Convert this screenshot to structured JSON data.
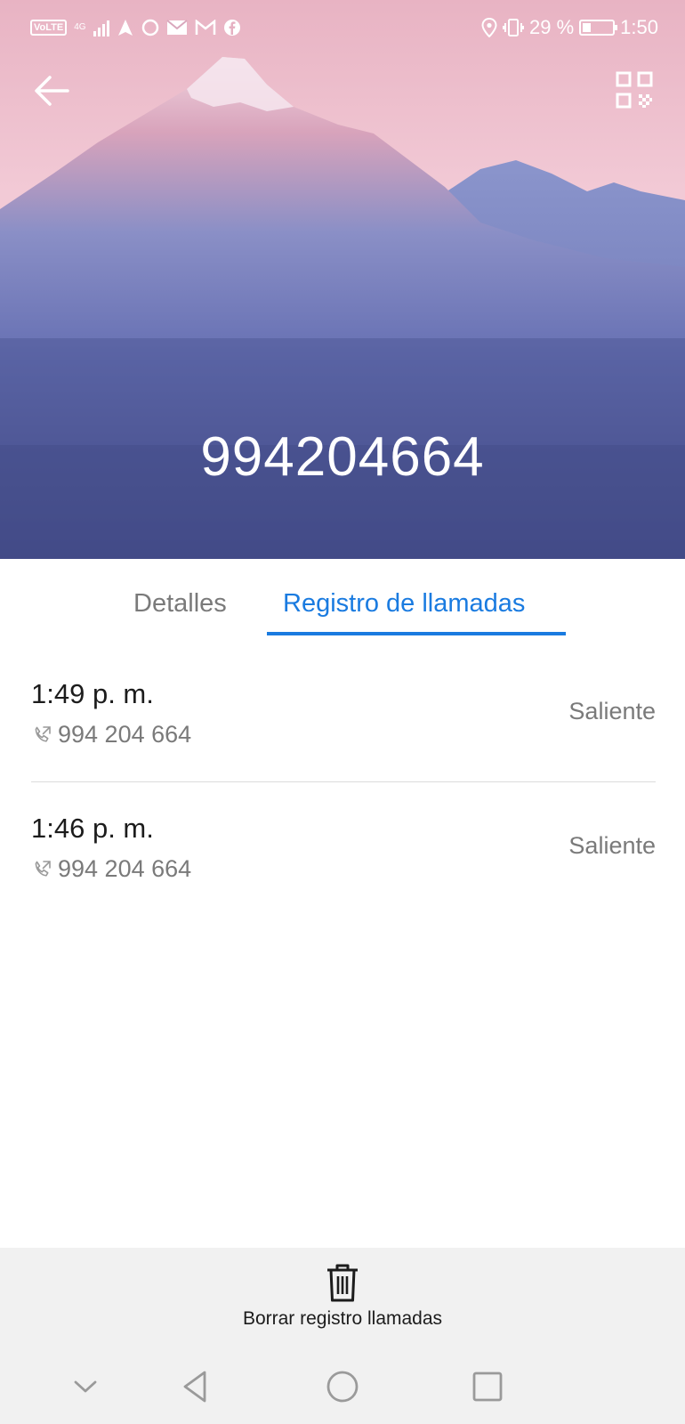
{
  "status_bar": {
    "volte": "VoLTE",
    "network": "4G",
    "battery_text": "29 %",
    "battery_level": 0.29,
    "time": "1:50",
    "icons": [
      "navigation-icon",
      "sync-icon",
      "mail-icon",
      "gmail-icon",
      "facebook-icon",
      "location-icon",
      "vibrate-icon",
      "battery-icon"
    ]
  },
  "header": {
    "phone_number": "994204664",
    "back_icon": "back-arrow-icon",
    "qr_icon": "qr-code-icon"
  },
  "tabs": [
    {
      "label": "Detalles",
      "selected": false
    },
    {
      "label": "Registro de llamadas",
      "selected": true
    }
  ],
  "calls": [
    {
      "time": "1:49 p. m.",
      "number": "994 204 664",
      "type": "Saliente"
    },
    {
      "time": "1:46 p. m.",
      "number": "994 204 664",
      "type": "Saliente"
    }
  ],
  "bottom_action": {
    "label": "Borrar registro llamadas",
    "icon": "trash-icon"
  },
  "navigation": [
    "hide-keyboard-icon",
    "back-icon",
    "home-icon",
    "recents-icon"
  ],
  "colors": {
    "accent": "#1a7be0",
    "secondary_text": "#7a7a7a",
    "hero_bottom": "#434b88",
    "hero_top": "#f1c6d2"
  }
}
